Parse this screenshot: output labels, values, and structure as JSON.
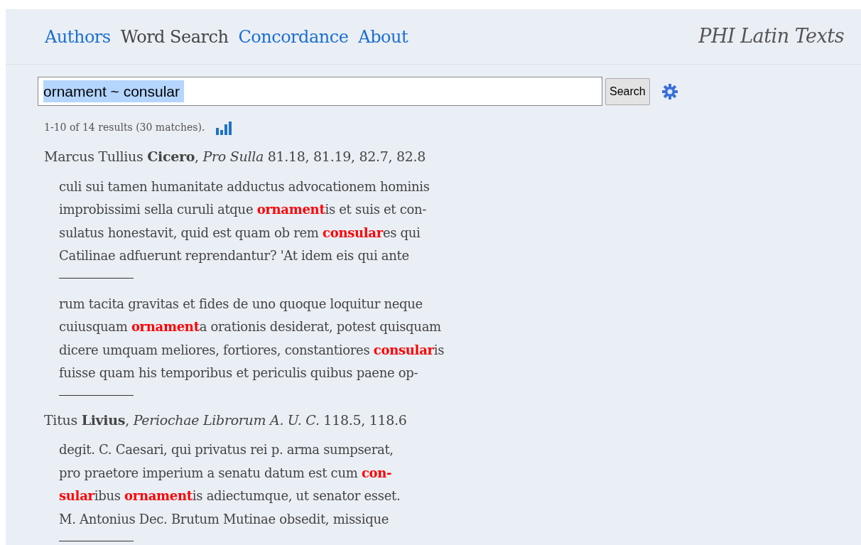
{
  "nav": [
    {
      "label": "Authors",
      "selected": false
    },
    {
      "label": "Word Search",
      "selected": true
    },
    {
      "label": "Concordance",
      "selected": false
    },
    {
      "label": "About",
      "selected": false
    }
  ],
  "site_title": "PHI Latin Texts",
  "search": {
    "value": "ornament ~ consular",
    "button": "Search"
  },
  "summary": "1-10 of 14 results (30 matches).",
  "results": [
    {
      "citation": "Marcus Tullius **Cicero**, *Pro Sulla* 81.18, 81.19, 82.7, 82.8",
      "passages": [
        [
          "culi sui tamen humanitate adductus advocationem hominis",
          "improbissimi sella curuli atque **ornament**is et suis et con-",
          "sulatus honestavit, quid est quam ob rem **consular**es qui",
          "Catilinae adfuerunt reprendantur? 'At idem eis qui ante"
        ],
        [
          "rum tacita gravitas et fides de uno quoque loquitur neque",
          "cuiusquam **ornament**a orationis desiderat, potest quisquam",
          "dicere umquam meliores, fortiores, constantiores **consular**is",
          "fuisse quam his temporibus et periculis quibus paene op-"
        ]
      ]
    },
    {
      "citation": "Titus **Livius**, *Periochae Librorum A. U. C.* 118.5, 118.6",
      "passages": [
        [
          "degit. C. Caesari, qui privatus rei p. arma sumpserat,",
          "pro praetore imperium a senatu datum est cum **con-**",
          "**sular**ibus **ornament**is adiectumque, ut senator esset.",
          "M. Antonius Dec. Brutum Mutinae obsedit, missique"
        ]
      ]
    }
  ]
}
